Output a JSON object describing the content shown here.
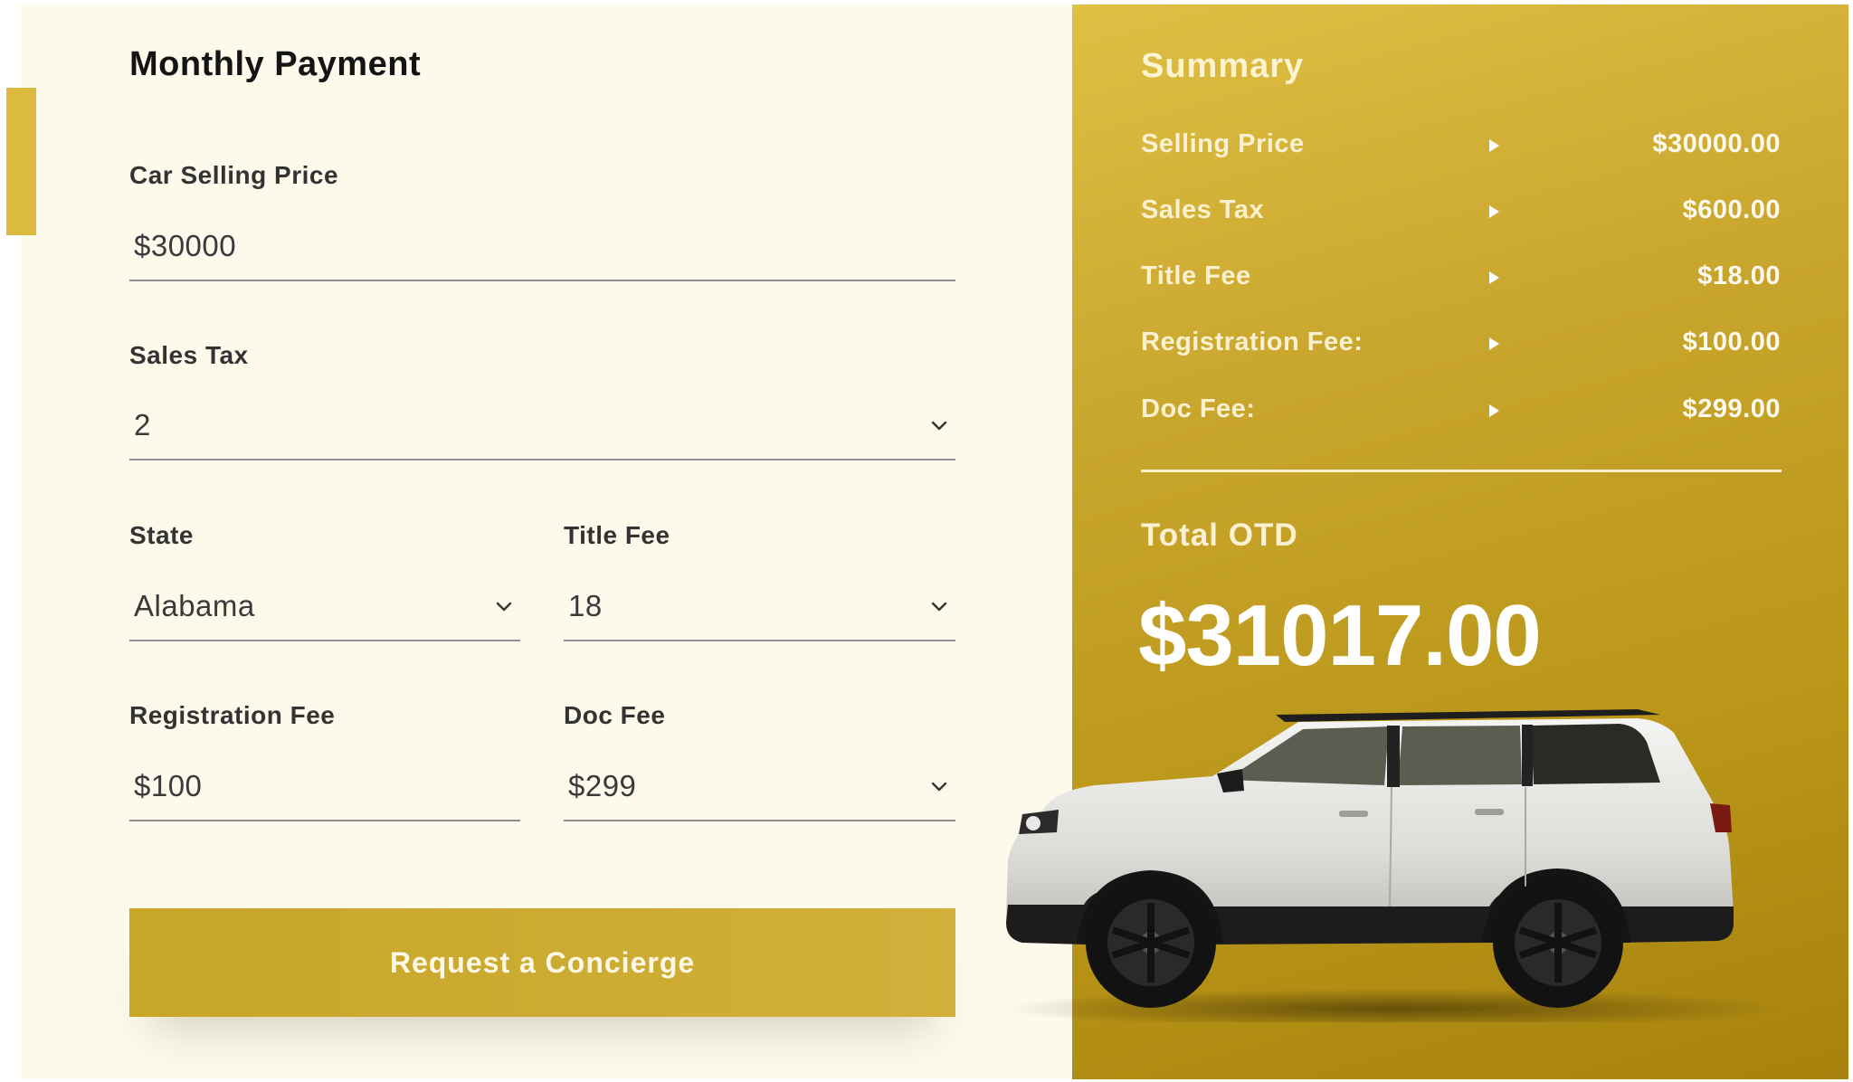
{
  "form": {
    "title": "Monthly Payment",
    "fields": {
      "car_selling_price": {
        "label": "Car Selling Price",
        "value": "$30000"
      },
      "sales_tax": {
        "label": "Sales Tax",
        "value": "2"
      },
      "state": {
        "label": "State",
        "value": "Alabama"
      },
      "title_fee": {
        "label": "Title Fee",
        "value": "18"
      },
      "registration_fee": {
        "label": "Registration Fee",
        "value": "$100"
      },
      "doc_fee": {
        "label": "Doc Fee",
        "value": "$299"
      }
    },
    "cta_label": "Request a Concierge"
  },
  "summary": {
    "title": "Summary",
    "rows": [
      {
        "label": "Selling Price",
        "value": "$30000.00"
      },
      {
        "label": "Sales Tax",
        "value": "$600.00"
      },
      {
        "label": "Title Fee",
        "value": "$18.00"
      },
      {
        "label": "Registration Fee:",
        "value": "$100.00"
      },
      {
        "label": "Doc Fee:",
        "value": "$299.00"
      }
    ],
    "total_label": "Total OTD",
    "total_value": "$31017.00"
  },
  "colors": {
    "accent": "#d1b03b",
    "panel_background": "#fdf9eb",
    "summary_gold": "#c8a52c"
  },
  "icons": {
    "dropdown": "chevron-down-icon",
    "row_marker": "triangle-right-icon"
  }
}
